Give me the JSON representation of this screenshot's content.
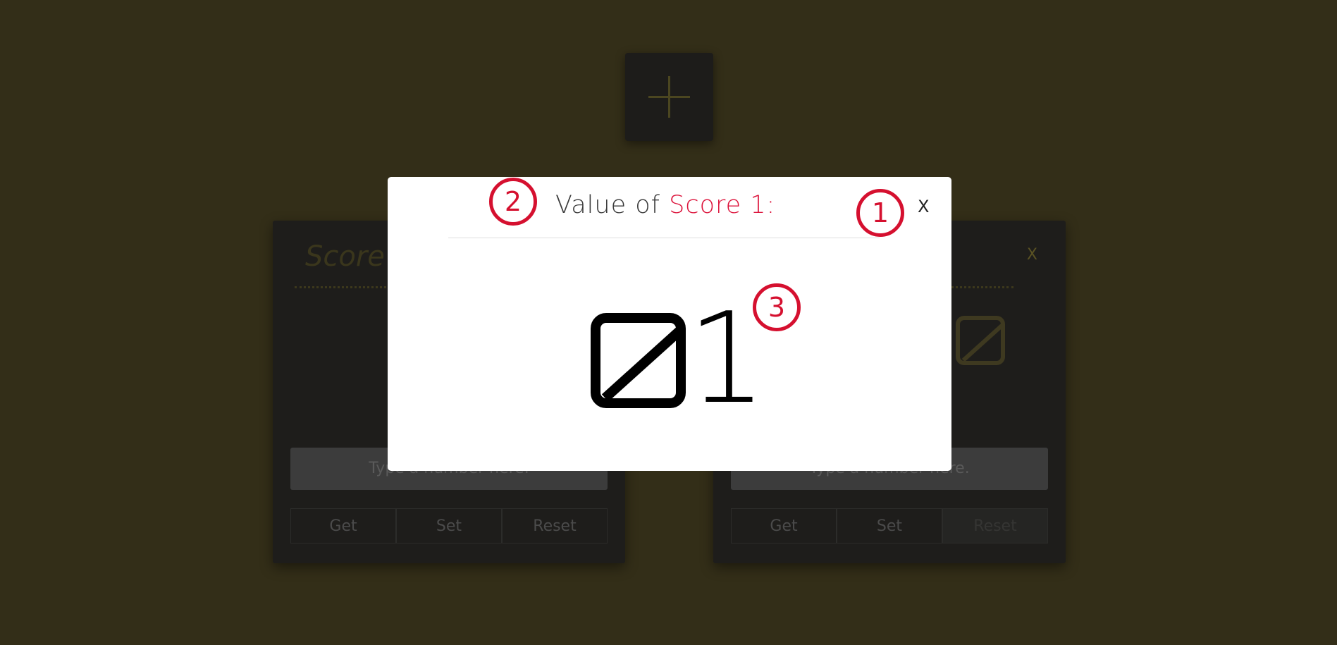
{
  "page": {
    "background_color": "#332e18"
  },
  "add_button": {
    "icon": "plus-icon"
  },
  "cards": [
    {
      "title": "Score",
      "close_label": "",
      "value_glyph": "Ø",
      "input_placeholder": "Type a number here.",
      "buttons": [
        "Get",
        "Set",
        "Reset"
      ]
    },
    {
      "title": "",
      "close_label": "X",
      "value_glyph": "Ø",
      "input_placeholder": "Type a number here.",
      "buttons": [
        "Get",
        "Set",
        "Reset"
      ]
    }
  ],
  "modal": {
    "title_prefix": "Value of ",
    "title_accent": "Score 1:",
    "close_label": "X",
    "value": "Ø1",
    "value_digit": "1",
    "accent_color": "#dc143c"
  },
  "markers": {
    "one": "1",
    "two": "2",
    "three": "3",
    "color": "#d5102f"
  }
}
